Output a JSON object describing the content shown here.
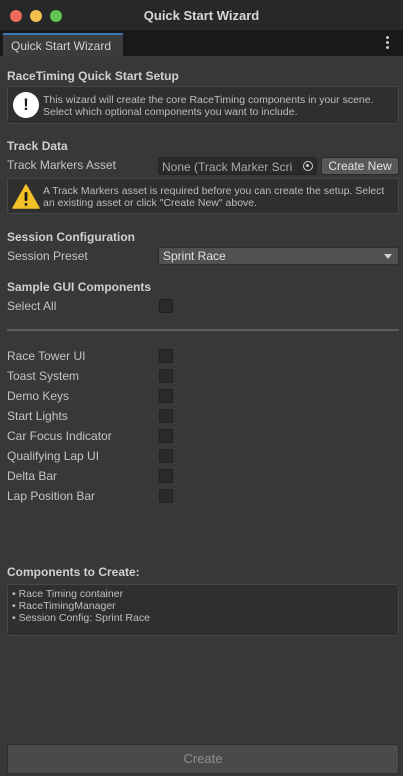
{
  "window": {
    "title": "Quick Start Wizard"
  },
  "tab": {
    "label": "Quick Start Wizard"
  },
  "setup": {
    "title": "RaceTiming Quick Start Setup",
    "info_line1": "This wizard will create the core RaceTiming components in your scene.",
    "info_line2": "Select which optional components you want to include."
  },
  "track": {
    "title": "Track Data",
    "asset_label": "Track Markers Asset",
    "asset_value": "None (Track Marker Scri",
    "create_new": "Create New",
    "warning_line1": "A Track Markers asset is required before you can create the setup. Select",
    "warning_line2": "an existing asset or click \"Create New\" above."
  },
  "session": {
    "title": "Session Configuration",
    "preset_label": "Session Preset",
    "preset_value": "Sprint Race"
  },
  "gui": {
    "title": "Sample GUI Components",
    "select_all": "Select All",
    "items": [
      {
        "label": "Race Tower UI",
        "checked": false
      },
      {
        "label": "Toast System",
        "checked": false
      },
      {
        "label": "Demo Keys",
        "checked": false
      },
      {
        "label": "Start Lights",
        "checked": false
      },
      {
        "label": "Car Focus Indicator",
        "checked": false
      },
      {
        "label": "Qualifying Lap UI",
        "checked": false
      },
      {
        "label": "Delta Bar",
        "checked": false
      },
      {
        "label": "Lap Position Bar",
        "checked": false
      }
    ]
  },
  "summary": {
    "title": "Components to Create:",
    "items": [
      "• Race Timing container",
      "• RaceTimingManager",
      "• Session Config: Sprint Race"
    ]
  },
  "footer": {
    "create_label": "Create"
  },
  "colors": {
    "accent": "#3a79bb",
    "background": "#383838",
    "warning": "#f4c028"
  }
}
